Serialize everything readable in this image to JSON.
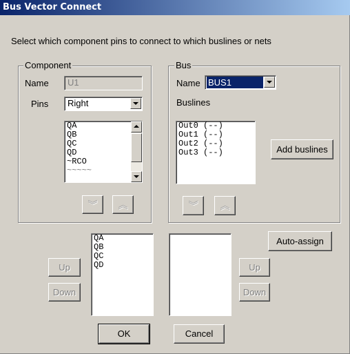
{
  "title": "Bus Vector Connect",
  "instruction": "Select which component pins to connect to which buslines or nets",
  "component": {
    "group_label": "Component",
    "name_label": "Name",
    "name_value": "U1",
    "pins_label": "Pins",
    "pins_value": "Right",
    "pins_list": [
      "QA",
      "QB",
      "QC",
      "QD",
      "~RCO",
      "~~~~~"
    ]
  },
  "bus": {
    "group_label": "Bus",
    "name_label": "Name",
    "name_value": "BUS1",
    "buslines_label": "Buslines",
    "buslines_list": [
      "Out0 (--)",
      "Out1 (--)",
      "Out2 (--)",
      "Out3 (--)"
    ],
    "add_buslines_label": "Add buslines"
  },
  "assign": {
    "left_list": [
      "QA",
      "QB",
      "QC",
      "QD"
    ],
    "right_list": [],
    "up_label": "Up",
    "down_label": "Down",
    "auto_assign_label": "Auto-assign"
  },
  "buttons": {
    "ok": "OK",
    "cancel": "Cancel"
  },
  "icons": {
    "chevron_down": "double-chevron-down-icon",
    "chevron_up": "double-chevron-up-icon"
  },
  "colors": {
    "title_start": "#0a246a",
    "title_end": "#a6caf0",
    "selection": "#0a246a",
    "face": "#d4d0c8"
  }
}
